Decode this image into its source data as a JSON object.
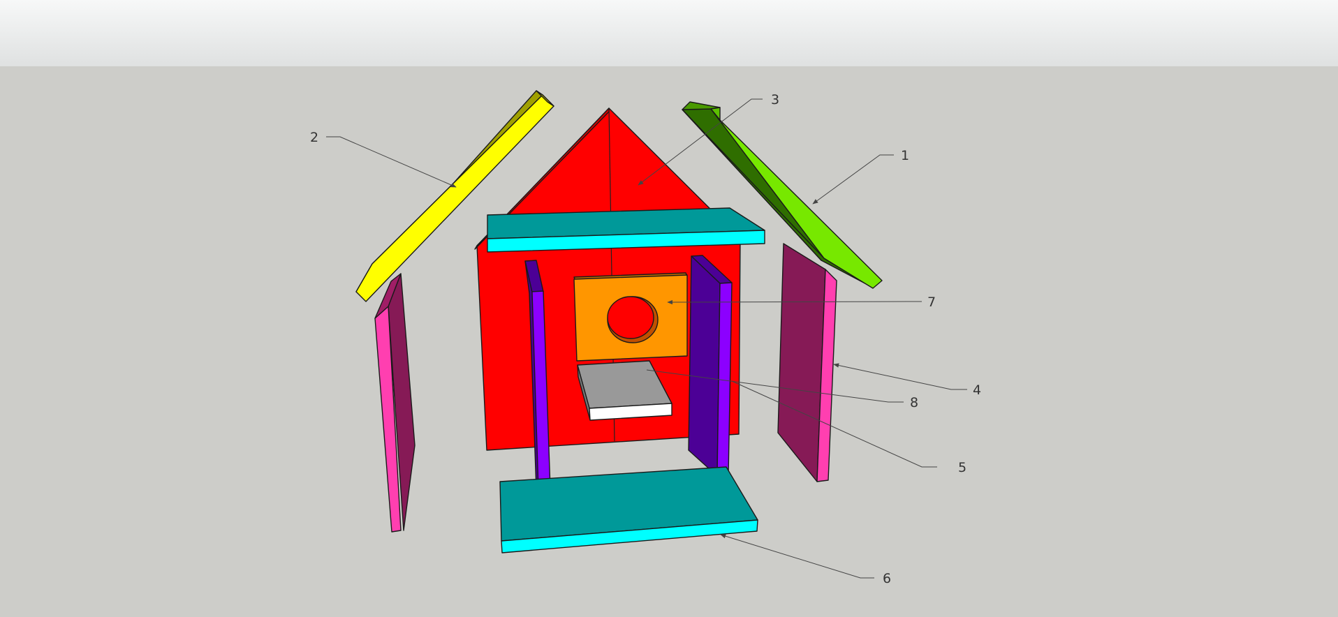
{
  "scene": {
    "sky_color_top": "#f7f8f8",
    "sky_color_bottom": "#dfe1e1",
    "ground_color": "#cdcdc9"
  },
  "parts": [
    {
      "id": "roof-right",
      "color": "#77e800",
      "shade": "#2f6e00"
    },
    {
      "id": "roof-left",
      "color": "#ffff00",
      "shade": "#a0a000"
    },
    {
      "id": "back-panel",
      "color": "#ff0000",
      "shade": "#d80000"
    },
    {
      "id": "side-panel-right",
      "color": "#ff3fb0",
      "shade": "#861a56"
    },
    {
      "id": "front-post",
      "color": "#8c00ff",
      "shade": "#4c0096"
    },
    {
      "id": "floor-shelf",
      "color": "#00ffff",
      "shade": "#009999"
    },
    {
      "id": "entrance-panel",
      "color": "#ff9600",
      "shade": "#c06a00"
    },
    {
      "id": "perch-block",
      "color": "#ffffff",
      "shade": "#999999"
    }
  ],
  "callouts": [
    {
      "label": "1"
    },
    {
      "label": "2"
    },
    {
      "label": "3"
    },
    {
      "label": "4"
    },
    {
      "label": "5"
    },
    {
      "label": "6"
    },
    {
      "label": "7"
    },
    {
      "label": "8"
    }
  ]
}
